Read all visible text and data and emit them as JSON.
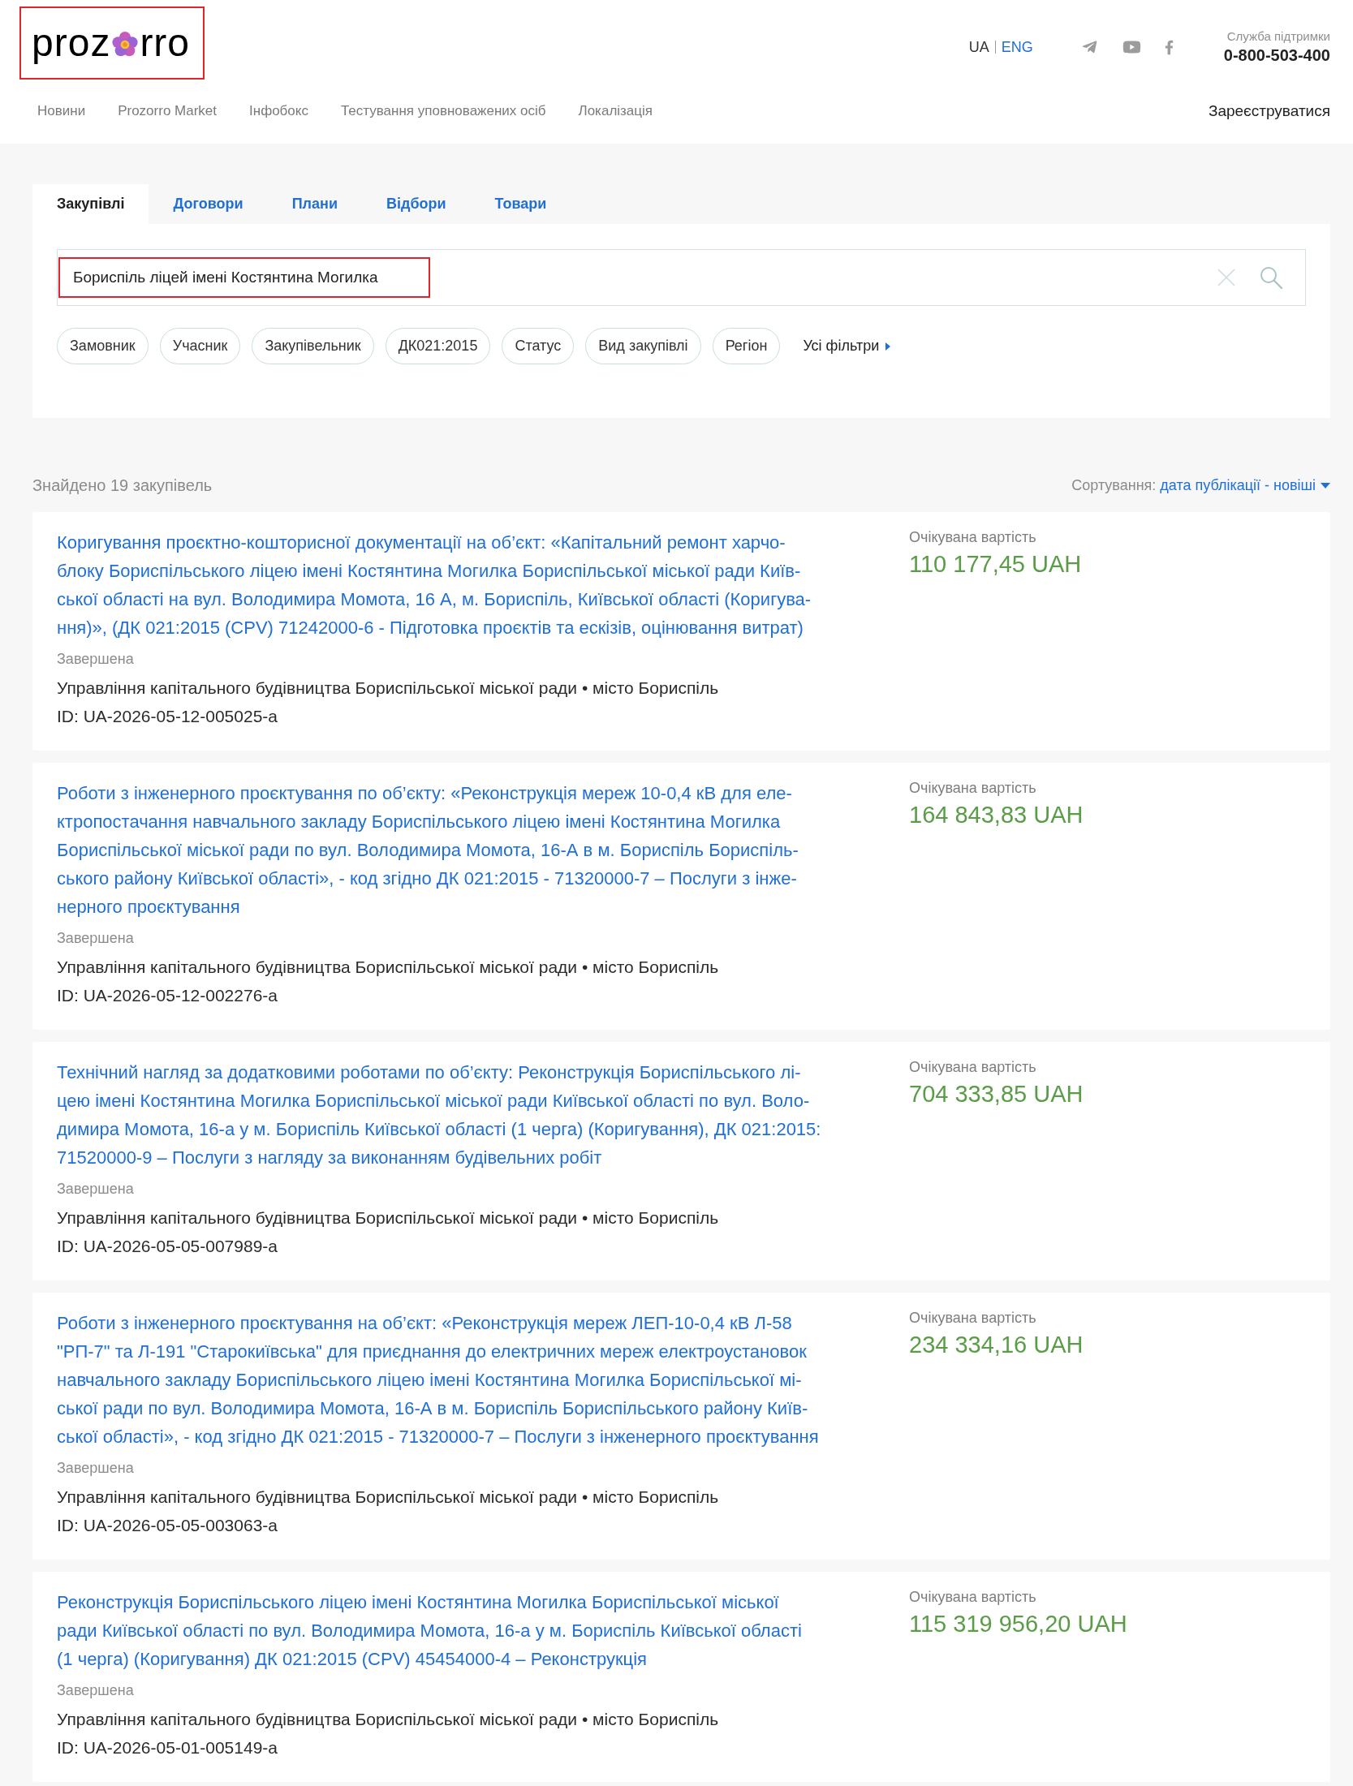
{
  "header": {
    "logo": {
      "text_start": "proz",
      "text_end": "rro",
      "highlighted": true
    },
    "languages": [
      {
        "label": "UA",
        "selected": true
      },
      {
        "label": "ENG",
        "selected": false
      }
    ],
    "support": {
      "label": "Служба підтримки",
      "phone": "0-800-503-400"
    },
    "nav": [
      "Новини",
      "Prozorro Market",
      "Інфобокс",
      "Тестування уповноважених осіб",
      "Локалізація"
    ],
    "register": "Зареєструватися"
  },
  "tabs": [
    {
      "label": "Закупівлі",
      "selected": true
    },
    {
      "label": "Договори",
      "selected": false
    },
    {
      "label": "Плани",
      "selected": false
    },
    {
      "label": "Відбори",
      "selected": false
    },
    {
      "label": "Товари",
      "selected": false
    }
  ],
  "search": {
    "value": "Бориспіль ліцей імені Костянтина Могилка",
    "highlighted": true
  },
  "filters": [
    {
      "label": "Замовник",
      "kind": "chip"
    },
    {
      "label": "Учасник",
      "kind": "chip"
    },
    {
      "label": "Закупівельник",
      "kind": "chip"
    },
    {
      "label": "ДК021:2015",
      "kind": "chip"
    },
    {
      "label": "Статус",
      "kind": "chip"
    },
    {
      "label": "Вид закупівлі",
      "kind": "chip"
    },
    {
      "label": "Регіон",
      "kind": "chip"
    },
    {
      "label": "Усі фільтри",
      "kind": "more"
    }
  ],
  "results": {
    "count": "Знайдено 19 закупівель",
    "sort_label": "Сортування:",
    "sort_value": "дата публікації - новіші"
  },
  "tenders": [
    {
      "title_lines": [
        "Коригування проєктно-кошторисної документації на об’єкт: «Капітальний ремонт харчо-",
        "блоку Бориспільського ліцею імені Костянтина Могилка Бориспільської міської ради Київ-",
        "ської області на вул. Володимира Момота, 16 А, м. Бориспіль, Київської області (Коригува-",
        "ння)», (ДК 021:2015 (CPV) 71242000-6 - Підготовка проєктів та ескізів, оцінювання витрат)"
      ],
      "status": "Завершена",
      "buyer": "Управління капітального будівництва Бориспільської міської ради • місто Бориспіль",
      "id": "ID: UA-2026-05-12-005025-a",
      "price_label": "Очікувана вартість",
      "price": "110 177,45 UAH"
    },
    {
      "title_lines": [
        "Роботи з інженерного проєктування по об’єкту: «Реконструкція мереж 10-0,4 кВ для еле-",
        "ктропостачання навчального закладу Бориспільського ліцею імені Костянтина Могилка",
        "Бориспільської міської ради по вул. Володимира Момота, 16-А в м. Бориспіль Бориспіль-",
        "ського району Київської області», - код згідно ДК 021:2015 - 71320000-7 – Послуги з інже-",
        "нерного проєктування"
      ],
      "status": "Завершена",
      "buyer": "Управління капітального будівництва Бориспільської міської ради • місто Бориспіль",
      "id": "ID: UA-2026-05-12-002276-a",
      "price_label": "Очікувана вартість",
      "price": "164 843,83 UAH"
    },
    {
      "title_lines": [
        "Технічний нагляд за додатковими роботами по об’єкту: Реконструкція Бориспільського лі-",
        "цею імені Костянтина Могилка Бориспільської міської ради Київської області по вул. Воло-",
        "димира Момота, 16-а у м. Бориспіль Київської області (1 черга) (Коригування), ДК 021:2015:",
        "71520000-9 – Послуги з нагляду за виконанням будівельних робіт"
      ],
      "status": "Завершена",
      "buyer": "Управління капітального будівництва Бориспільської міської ради • місто Бориспіль",
      "id": "ID: UA-2026-05-05-007989-a",
      "price_label": "Очікувана вартість",
      "price": "704 333,85 UAH"
    },
    {
      "title_lines": [
        "Роботи з інженерного проєктування на об’єкт: «Реконструкція мереж ЛЕП-10-0,4 кВ Л-58",
        "\"РП-7\" та Л-191 \"Старокиївська\" для приєднання до електричних мереж електроустановок",
        "навчального закладу Бориспільського ліцею імені Костянтина Могилка Бориспільської мі-",
        "ської ради по вул. Володимира Момота, 16-А в м. Бориспіль Бориспільського району Київ-",
        "ської області», - код згідно ДК 021:2015 - 71320000-7 – Послуги з інженерного проєктування"
      ],
      "status": "Завершена",
      "buyer": "Управління капітального будівництва Бориспільської міської ради • місто Бориспіль",
      "id": "ID: UA-2026-05-05-003063-a",
      "price_label": "Очікувана вартість",
      "price": "234 334,16 UAH"
    },
    {
      "title_lines": [
        "Реконструкція Бориспільського ліцею імені Костянтина Могилка Бориспільської міської",
        "ради Київської області по вул. Володимира Момота, 16-а у м. Бориспіль Київської області",
        "(1 черга) (Коригування) ДК 021:2015 (CPV) 45454000-4 – Реконструкція"
      ],
      "status": "Завершена",
      "buyer": "Управління капітального будівництва Бориспільської міської ради • місто Бориспіль",
      "id": "ID: UA-2026-05-01-005149-a",
      "price_label": "Очікувана вартість",
      "price": "115 319 956,20 UAH"
    }
  ]
}
